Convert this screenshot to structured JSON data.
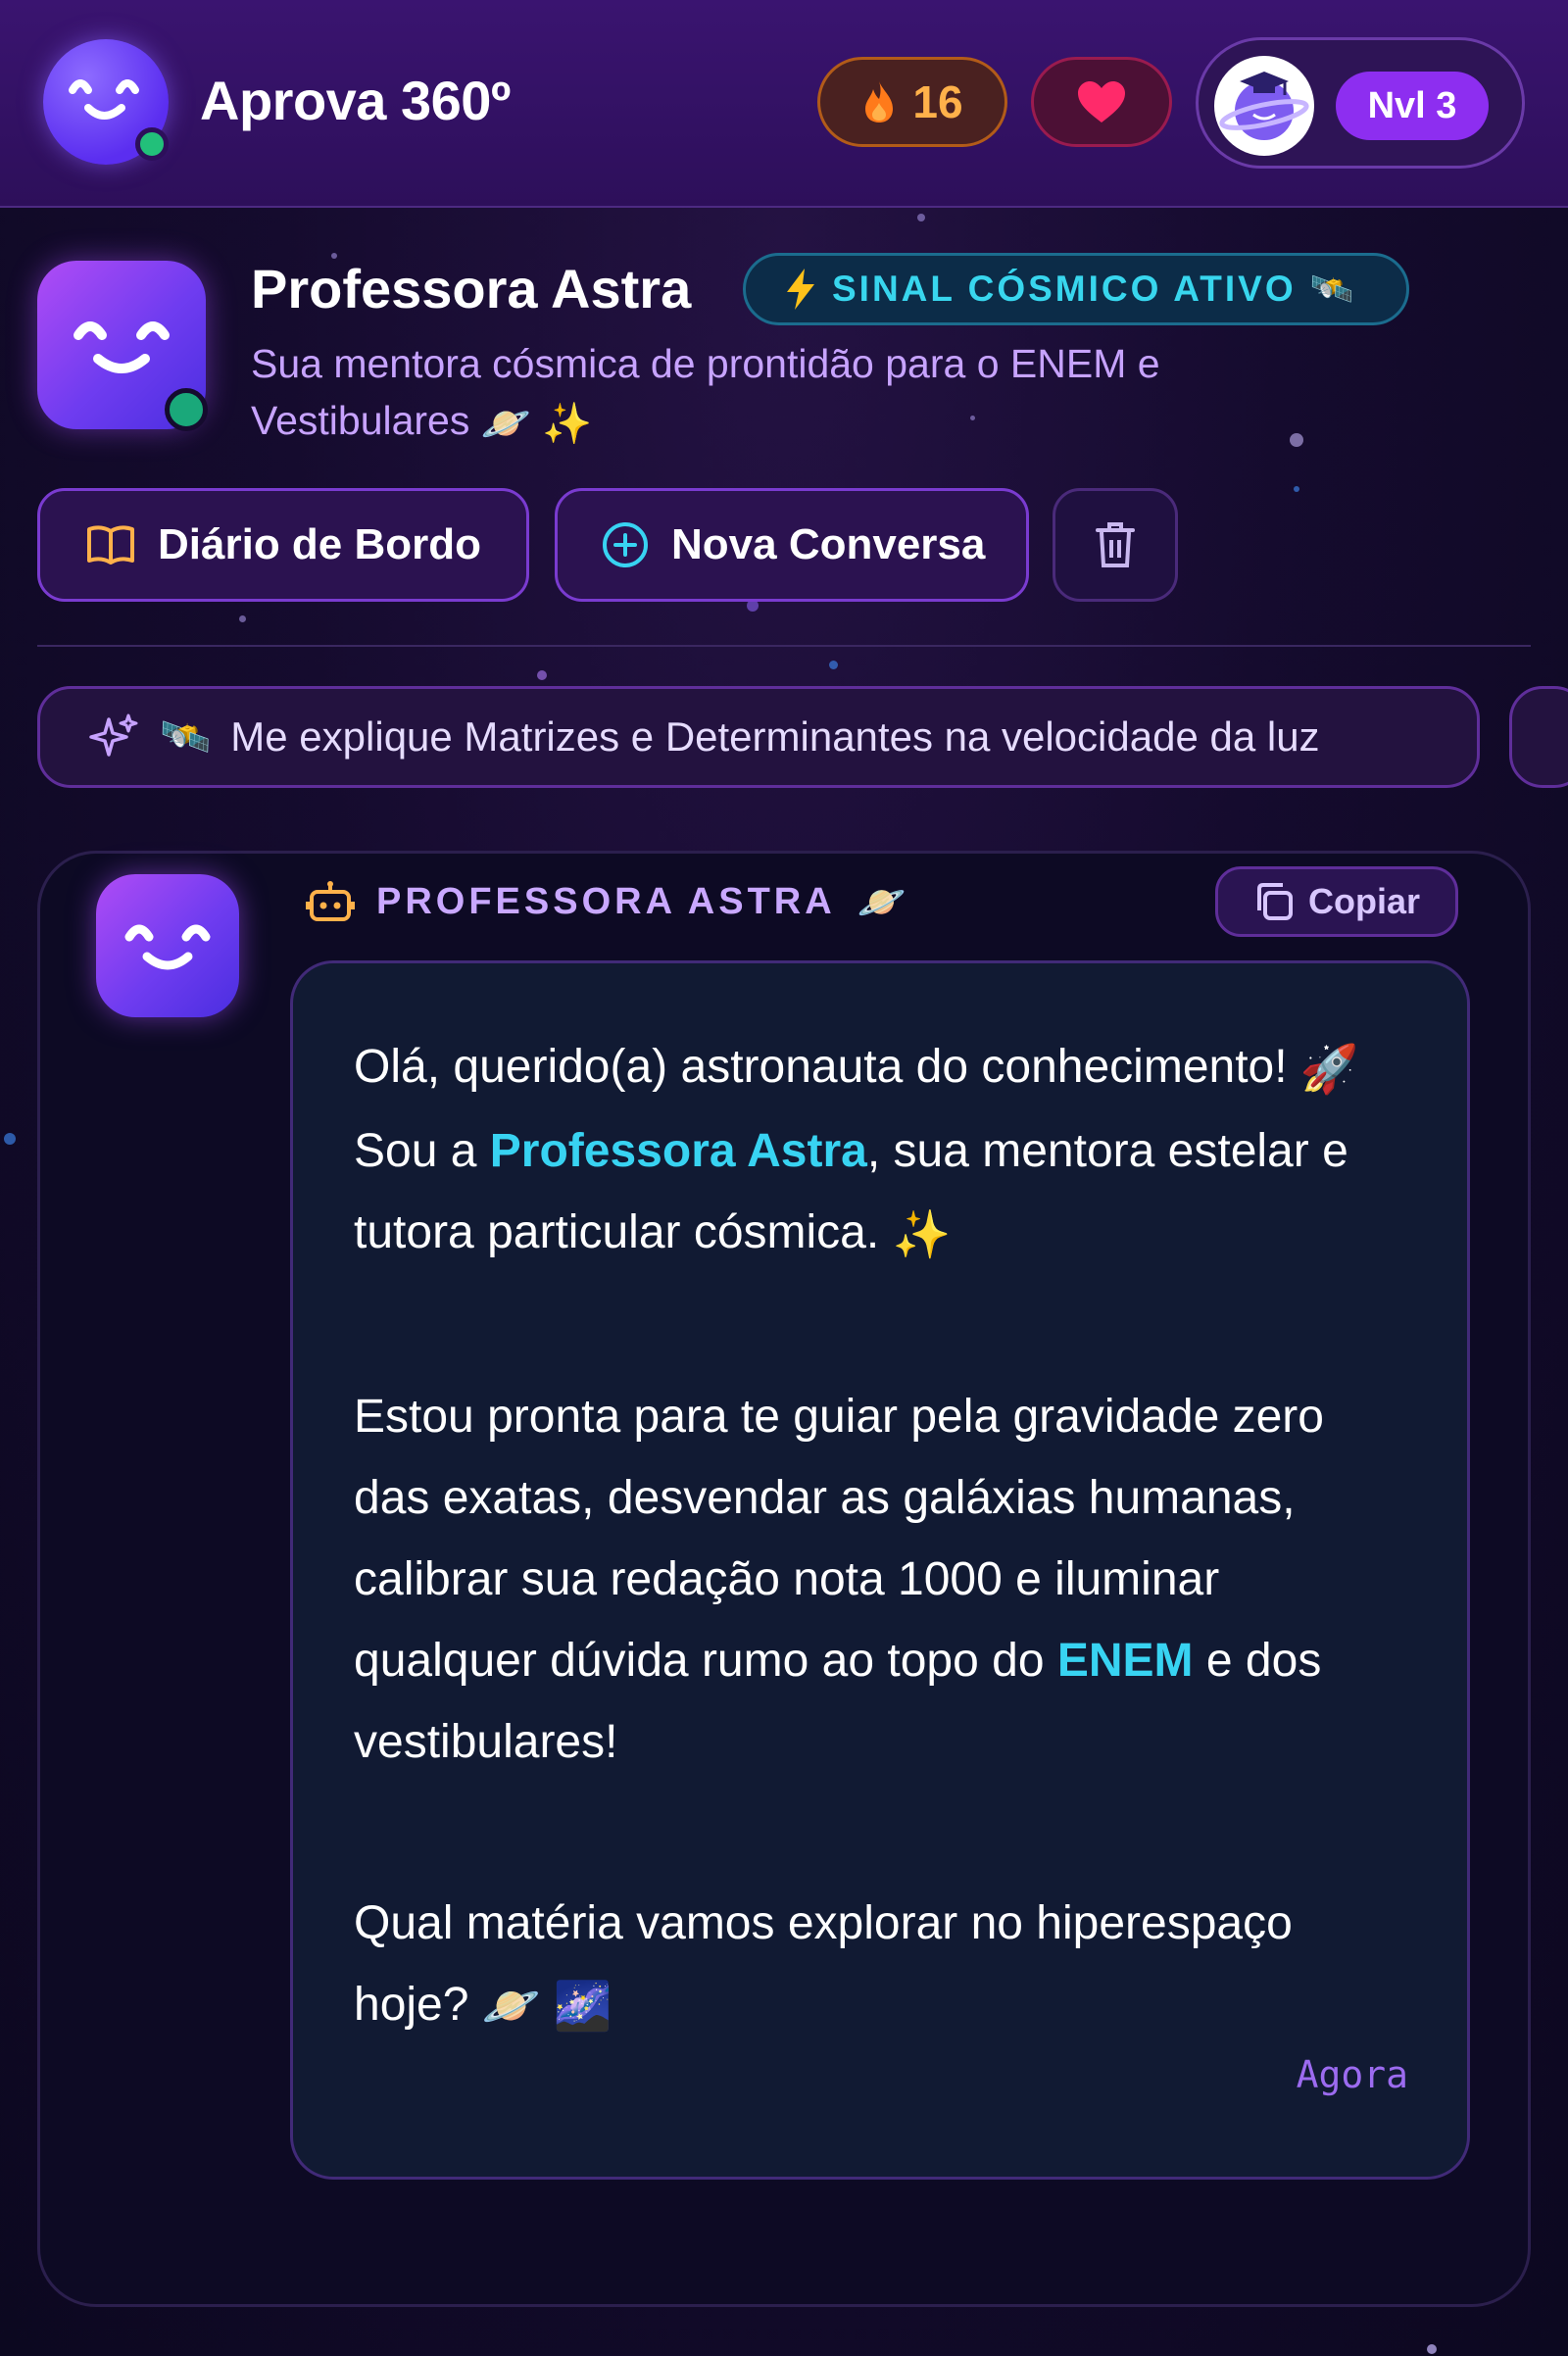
{
  "app": {
    "title": "Aprova 360º",
    "streak": "16",
    "level": "Nvl 3"
  },
  "tutor": {
    "name": "Professora Astra",
    "signal_badge": "SINAL CÓSMICO ATIVO",
    "subtitle": "Sua mentora cósmica de prontidão para o ENEM e Vestibulares"
  },
  "actions": {
    "diario": "Diário de Bordo",
    "nova": "Nova Conversa"
  },
  "suggestion": "Me explique Matrizes e Determinantes na velocidade da luz",
  "message": {
    "sender": "PROFESSORA ASTRA",
    "copy": "Copiar",
    "p1_a": "Olá, querido(a) astronauta do conhecimento!",
    "p1_b": "Sou a",
    "p1_hl": "Professora Astra",
    "p1_c": ", sua mentora estelar e tutora particular cósmica.",
    "p2_a": "Estou pronta para te guiar pela gravidade zero das exatas, desvendar as galáxias humanas, calibrar sua redação nota 1000 e iluminar qualquer dúvida rumo ao topo do",
    "p2_hl": "ENEM",
    "p2_b": "e dos vestibulares!",
    "p3": "Qual matéria vamos explorar no hiperespaço hoje?",
    "timestamp": "Agora"
  },
  "icons": {
    "logo": "smile-face-icon",
    "streak": "fire-icon",
    "lives": "heart-icon",
    "signal": "lightning-icon",
    "diario": "book-open-icon",
    "nova": "plus-circle-icon",
    "trash": "trash-icon",
    "suggestion": "sparkles-icon",
    "sender": "robot-icon",
    "copy": "copy-icon"
  },
  "colors": {
    "accent_purple": "#8d2ef0",
    "highlight_cyan": "#38d3f2",
    "streak_orange": "#ffb14a",
    "online_green": "#22c07a"
  }
}
